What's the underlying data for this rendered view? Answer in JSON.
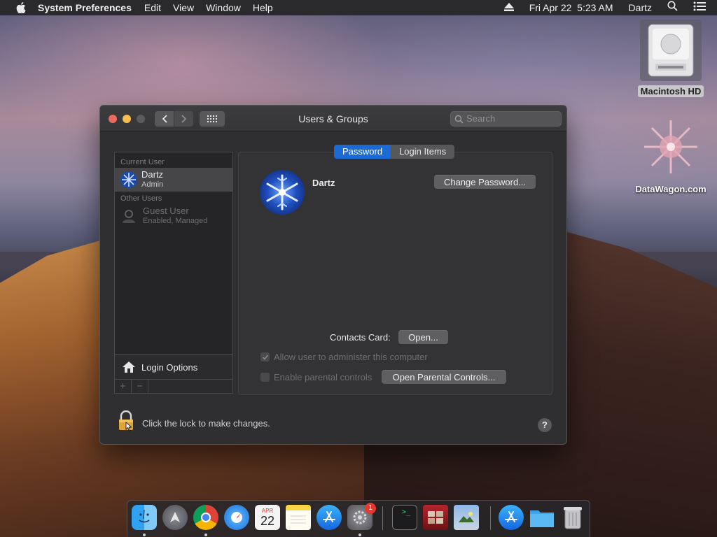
{
  "menubar": {
    "app_name": "System Preferences",
    "menus": [
      "Edit",
      "View",
      "Window",
      "Help"
    ],
    "date_time": "Fri Apr 22  5:23 AM",
    "user": "Dartz"
  },
  "desktop": {
    "hd_label": "Macintosh HD",
    "datawagon_label": "DataWagon.com"
  },
  "window": {
    "title": "Users & Groups",
    "search_placeholder": "Search"
  },
  "sidebar": {
    "current_header": "Current User",
    "current_user": {
      "name": "Dartz",
      "role": "Admin"
    },
    "other_header": "Other Users",
    "other_user": {
      "name": "Guest User",
      "role": "Enabled, Managed"
    },
    "login_options": "Login Options",
    "add": "+",
    "remove": "−"
  },
  "detail": {
    "tabs": [
      "Password",
      "Login Items"
    ],
    "active_tab": "Password",
    "full_name": "Dartz",
    "change_password": "Change Password...",
    "contacts_label": "Contacts Card:",
    "open_button": "Open...",
    "allow_admin": {
      "label": "Allow user to administer this computer",
      "checked": true,
      "disabled": true
    },
    "parental": {
      "label": "Enable parental controls",
      "checked": false,
      "disabled": true
    },
    "parental_button": "Open Parental Controls..."
  },
  "bottom": {
    "lock_text": "Click the lock to make changes.",
    "help": "?"
  },
  "dock": {
    "items": [
      "Finder",
      "Launchpad",
      "Chrome",
      "Safari",
      "Calendar",
      "Notes",
      "App Store",
      "System Preferences",
      "Terminal",
      "Photo Booth",
      "Preview",
      "App Store Downloads",
      "Folder",
      "Trash"
    ],
    "calendar_month": "APR",
    "calendar_day": "22",
    "sysprefs_badge": "1"
  },
  "colors": {
    "accent": "#1b6bd6",
    "close": "#ed6a5e",
    "minimize": "#f5bf4f",
    "badge": "#e5382f"
  }
}
